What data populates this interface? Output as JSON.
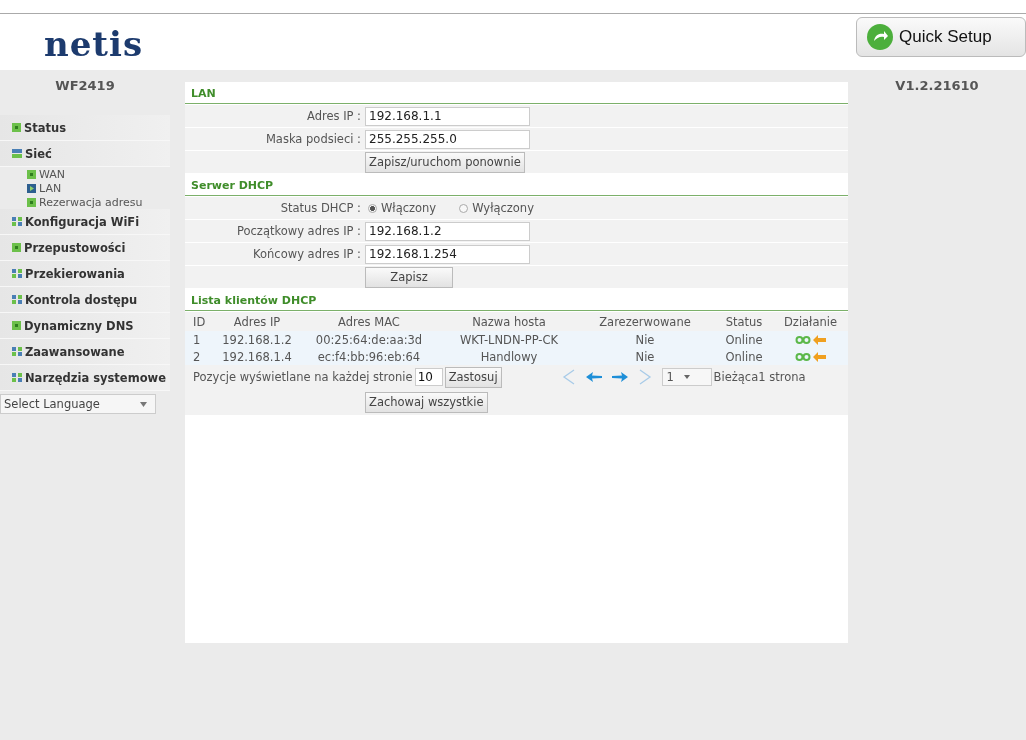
{
  "header": {
    "logo": "netis",
    "quick_setup": "Quick Setup"
  },
  "sidebar": {
    "model": "WF2419",
    "items": [
      {
        "label": "Status",
        "kind": "square"
      },
      {
        "label": "Sieć",
        "kind": "bars",
        "children": [
          {
            "label": "WAN",
            "selected": false
          },
          {
            "label": "LAN",
            "selected": true
          },
          {
            "label": "Rezerwacja adresu",
            "selected": false
          }
        ]
      },
      {
        "label": "Konfiguracja WiFi",
        "kind": "grid"
      },
      {
        "label": "Przepustowości",
        "kind": "square"
      },
      {
        "label": "Przekierowania",
        "kind": "grid"
      },
      {
        "label": "Kontrola dostępu",
        "kind": "grid"
      },
      {
        "label": "Dynamiczny DNS",
        "kind": "square"
      },
      {
        "label": "Zaawansowane",
        "kind": "grid"
      },
      {
        "label": "Narzędzia systemowe",
        "kind": "grid"
      }
    ],
    "language": "Select Language"
  },
  "version": "V1.2.21610",
  "lan": {
    "title": "LAN",
    "fields": [
      {
        "label": "Adres IP :",
        "value": "192.168.1.1"
      },
      {
        "label": "Maska podsieci :",
        "value": "255.255.255.0"
      }
    ],
    "button": "Zapisz/uruchom ponownie"
  },
  "dhcp": {
    "title": "Serwer DHCP",
    "status_label": "Status DHCP :",
    "options": [
      {
        "label": "Włączony",
        "selected": true
      },
      {
        "label": "Wyłączony",
        "selected": false
      }
    ],
    "fields": [
      {
        "label": "Początkowy adres IP :",
        "value": "192.168.1.2"
      },
      {
        "label": "Końcowy adres IP :",
        "value": "192.168.1.254"
      }
    ],
    "button": "Zapisz"
  },
  "clients": {
    "title": "Lista klientów DHCP",
    "columns": [
      "ID",
      "Adres IP",
      "Adres MAC",
      "Nazwa hosta",
      "Zarezerwowane",
      "Status",
      "Działanie"
    ],
    "rows": [
      [
        "1",
        "192.168.1.2",
        "00:25:64:de:aa:3d",
        "WKT-LNDN-PP-CK",
        "Nie",
        "Online"
      ],
      [
        "2",
        "192.168.1.4",
        "ec:f4:bb:96:eb:64",
        "Handlowy",
        "Nie",
        "Online"
      ]
    ],
    "per_page_label": "Pozycje wyświetlane na każdej stronie",
    "per_page": "10",
    "apply": "Zastosuj",
    "page": "1",
    "page_suffix": "Bieżąca1 strona",
    "save_all": "Zachowaj wszystkie"
  }
}
